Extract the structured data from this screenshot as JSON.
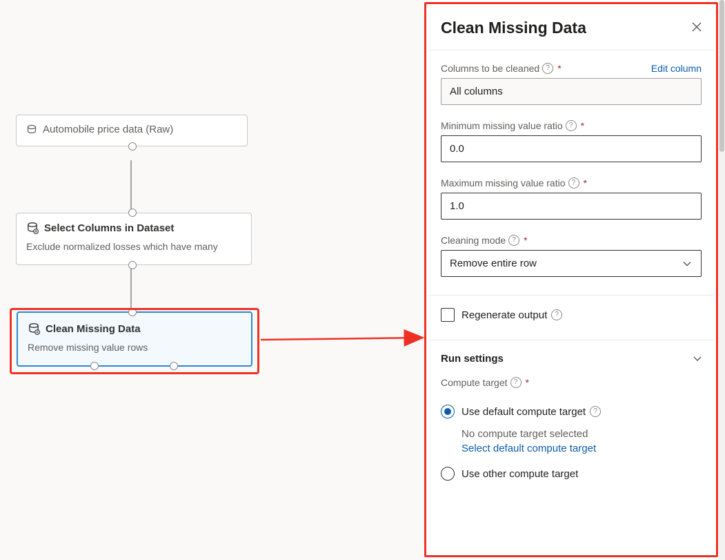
{
  "canvas": {
    "nodes": {
      "dataset": {
        "title": "Automobile price data (Raw)"
      },
      "select": {
        "title": "Select Columns in Dataset",
        "subtitle": "Exclude normalized losses which have many"
      },
      "clean": {
        "title": "Clean Missing Data",
        "subtitle": "Remove missing value rows"
      }
    }
  },
  "panel": {
    "title": "Clean Missing Data",
    "fields": {
      "columns": {
        "label": "Columns to be cleaned",
        "value": "All columns",
        "edit_link": "Edit column"
      },
      "min_ratio": {
        "label": "Minimum missing value ratio",
        "value": "0.0"
      },
      "max_ratio": {
        "label": "Maximum missing value ratio",
        "value": "1.0"
      },
      "mode": {
        "label": "Cleaning mode",
        "value": "Remove entire row"
      },
      "regenerate": {
        "label": "Regenerate output"
      }
    },
    "run_settings": {
      "title": "Run settings",
      "compute_target_label": "Compute target",
      "option_default": "Use default compute target",
      "default_status": "No compute target selected",
      "default_action": "Select default compute target",
      "option_other": "Use other compute target"
    }
  }
}
